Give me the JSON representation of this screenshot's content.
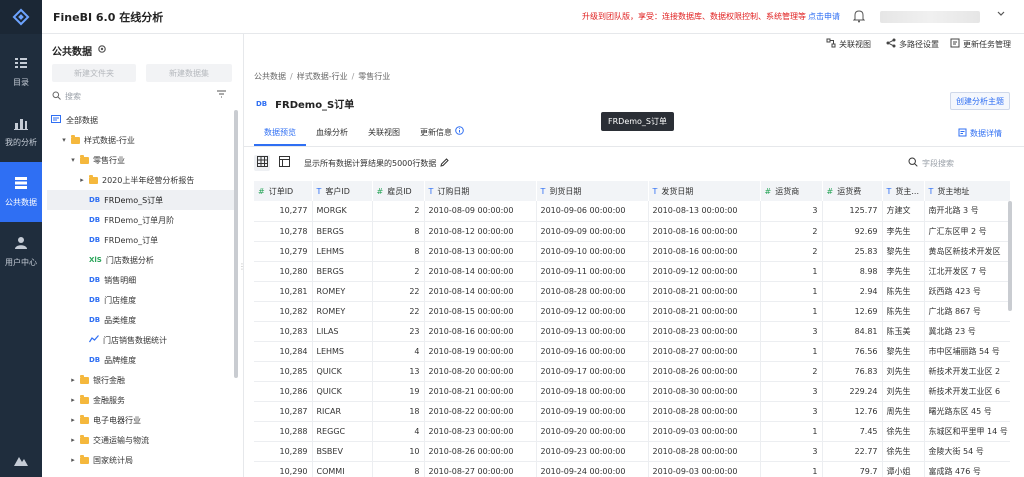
{
  "app": {
    "title": "FineBI 6.0 在线分析"
  },
  "topbar": {
    "promo": "升级到团队版，享受：连接数据库、数据权限控制、系统管理等",
    "apply": "点击申请"
  },
  "rail": [
    {
      "label": "目录",
      "icon": "catalog-icon"
    },
    {
      "label": "我的分析",
      "icon": "analysis-icon"
    },
    {
      "label": "公共数据",
      "icon": "public-data-icon",
      "active": true
    },
    {
      "label": "用户中心",
      "icon": "user-icon"
    }
  ],
  "leftpanel": {
    "title": "公共数据",
    "new_folder": "新建文件夹",
    "new_dataset": "新建数据集",
    "search_placeholder": "搜索",
    "tree": [
      {
        "label": "全部数据",
        "kind": "root",
        "level": 0
      },
      {
        "label": "样式数据-行业",
        "kind": "folder",
        "level": 1,
        "open": true
      },
      {
        "label": "零售行业",
        "kind": "folder",
        "level": 2,
        "open": true
      },
      {
        "label": "2020上半年经营分析报告",
        "kind": "folder",
        "level": 3,
        "open": false
      },
      {
        "label": "FRDemo_S订单",
        "kind": "db",
        "level": 3,
        "selected": true
      },
      {
        "label": "FRDemo_订单月阶",
        "kind": "db",
        "level": 3
      },
      {
        "label": "FRDemo_订单",
        "kind": "db",
        "level": 3
      },
      {
        "label": "门店数据分析",
        "kind": "xls",
        "level": 3
      },
      {
        "label": "销售明细",
        "kind": "db",
        "level": 3
      },
      {
        "label": "门店维度",
        "kind": "db",
        "level": 3
      },
      {
        "label": "品类维度",
        "kind": "db",
        "level": 3
      },
      {
        "label": "门店销售数据统计",
        "kind": "chart",
        "level": 3
      },
      {
        "label": "品牌维度",
        "kind": "db",
        "level": 3
      },
      {
        "label": "银行金融",
        "kind": "folder",
        "level": 2,
        "open": false
      },
      {
        "label": "金融服务",
        "kind": "folder",
        "level": 2,
        "open": false
      },
      {
        "label": "电子电器行业",
        "kind": "folder",
        "level": 2,
        "open": false
      },
      {
        "label": "交通运输与物流",
        "kind": "folder",
        "level": 2,
        "open": false
      },
      {
        "label": "国家统计局",
        "kind": "folder",
        "level": 2,
        "open": false
      }
    ]
  },
  "main": {
    "tools": {
      "relation": "关联视图",
      "multipath": "多路径设置",
      "update": "更新任务管理"
    },
    "breadcrumb": [
      "公共数据",
      "样式数据-行业",
      "零售行业"
    ],
    "dataset_tag": "DB",
    "dataset_title": "FRDemo_S订单",
    "create_topic": "创建分析主题",
    "tooltip": "FRDemo_S订单",
    "tabs": [
      "数据预览",
      "血缘分析",
      "关联视图",
      "更新信息"
    ],
    "detail": "数据详情",
    "preview_note": "显示所有数据计算结果的5000行数据",
    "field_search": "字段搜索"
  },
  "table": {
    "columns": [
      {
        "label": "订单ID",
        "type": "#"
      },
      {
        "label": "客户ID",
        "type": "T"
      },
      {
        "label": "雇员ID",
        "type": "#"
      },
      {
        "label": "订购日期",
        "type": "T"
      },
      {
        "label": "到货日期",
        "type": "T"
      },
      {
        "label": "发货日期",
        "type": "T"
      },
      {
        "label": "运货商",
        "type": "#"
      },
      {
        "label": "运货费",
        "type": "#"
      },
      {
        "label": "货主...",
        "type": "T"
      },
      {
        "label": "货主地址",
        "type": "T"
      }
    ],
    "rows": [
      [
        "10,277",
        "MORGK",
        "2",
        "2010-08-09 00:00:00",
        "2010-09-06 00:00:00",
        "2010-08-13 00:00:00",
        "3",
        "125.77",
        "方建文",
        "南开北路 3 号"
      ],
      [
        "10,278",
        "BERGS",
        "8",
        "2010-08-12 00:00:00",
        "2010-09-09 00:00:00",
        "2010-08-16 00:00:00",
        "2",
        "92.69",
        "李先生",
        "广汇东区甲 2 号"
      ],
      [
        "10,279",
        "LEHMS",
        "8",
        "2010-08-13 00:00:00",
        "2010-09-10 00:00:00",
        "2010-08-16 00:00:00",
        "2",
        "25.83",
        "黎先生",
        "黄岛区新技术开发区"
      ],
      [
        "10,280",
        "BERGS",
        "2",
        "2010-08-14 00:00:00",
        "2010-09-11 00:00:00",
        "2010-09-12 00:00:00",
        "1",
        "8.98",
        "李先生",
        "江北开发区 7 号"
      ],
      [
        "10,281",
        "ROMEY",
        "22",
        "2010-08-14 00:00:00",
        "2010-08-28 00:00:00",
        "2010-08-21 00:00:00",
        "1",
        "2.94",
        "陈先生",
        "跃西路 423 号"
      ],
      [
        "10,282",
        "ROMEY",
        "22",
        "2010-08-15 00:00:00",
        "2010-09-12 00:00:00",
        "2010-08-21 00:00:00",
        "1",
        "12.69",
        "陈先生",
        "广北路 867 号"
      ],
      [
        "10,283",
        "LILAS",
        "23",
        "2010-08-16 00:00:00",
        "2010-09-13 00:00:00",
        "2010-08-23 00:00:00",
        "3",
        "84.81",
        "陈玉美",
        "冀北路 23 号"
      ],
      [
        "10,284",
        "LEHMS",
        "4",
        "2010-08-19 00:00:00",
        "2010-09-16 00:00:00",
        "2010-08-27 00:00:00",
        "1",
        "76.56",
        "黎先生",
        "市中区埔丽路 54 号"
      ],
      [
        "10,285",
        "QUICK",
        "13",
        "2010-08-20 00:00:00",
        "2010-09-17 00:00:00",
        "2010-08-26 00:00:00",
        "2",
        "76.83",
        "刘先生",
        "新技术开发工业区 2"
      ],
      [
        "10,286",
        "QUICK",
        "19",
        "2010-08-21 00:00:00",
        "2010-09-18 00:00:00",
        "2010-08-30 00:00:00",
        "3",
        "229.24",
        "刘先生",
        "新技术开发工业区 6"
      ],
      [
        "10,287",
        "RICAR",
        "18",
        "2010-08-22 00:00:00",
        "2010-09-19 00:00:00",
        "2010-08-28 00:00:00",
        "3",
        "12.76",
        "周先生",
        "曙光路东区 45 号"
      ],
      [
        "10,288",
        "REGGC",
        "4",
        "2010-08-23 00:00:00",
        "2010-09-20 00:00:00",
        "2010-09-03 00:00:00",
        "1",
        "7.45",
        "徐先生",
        "东城区和平里甲 14 号"
      ],
      [
        "10,289",
        "BSBEV",
        "10",
        "2010-08-26 00:00:00",
        "2010-09-23 00:00:00",
        "2010-08-28 00:00:00",
        "3",
        "22.77",
        "徐先生",
        "金陵大街 54 号"
      ],
      [
        "10,290",
        "COMMI",
        "8",
        "2010-08-27 00:00:00",
        "2010-09-24 00:00:00",
        "2010-09-03 00:00:00",
        "1",
        "79.7",
        "谭小姐",
        "富成路 476 号"
      ]
    ]
  },
  "colors": {
    "accent": "#2f6ff3",
    "rail_bg": "#1f2d3d",
    "promo": "#e02020",
    "folder": "#f5b83d"
  }
}
